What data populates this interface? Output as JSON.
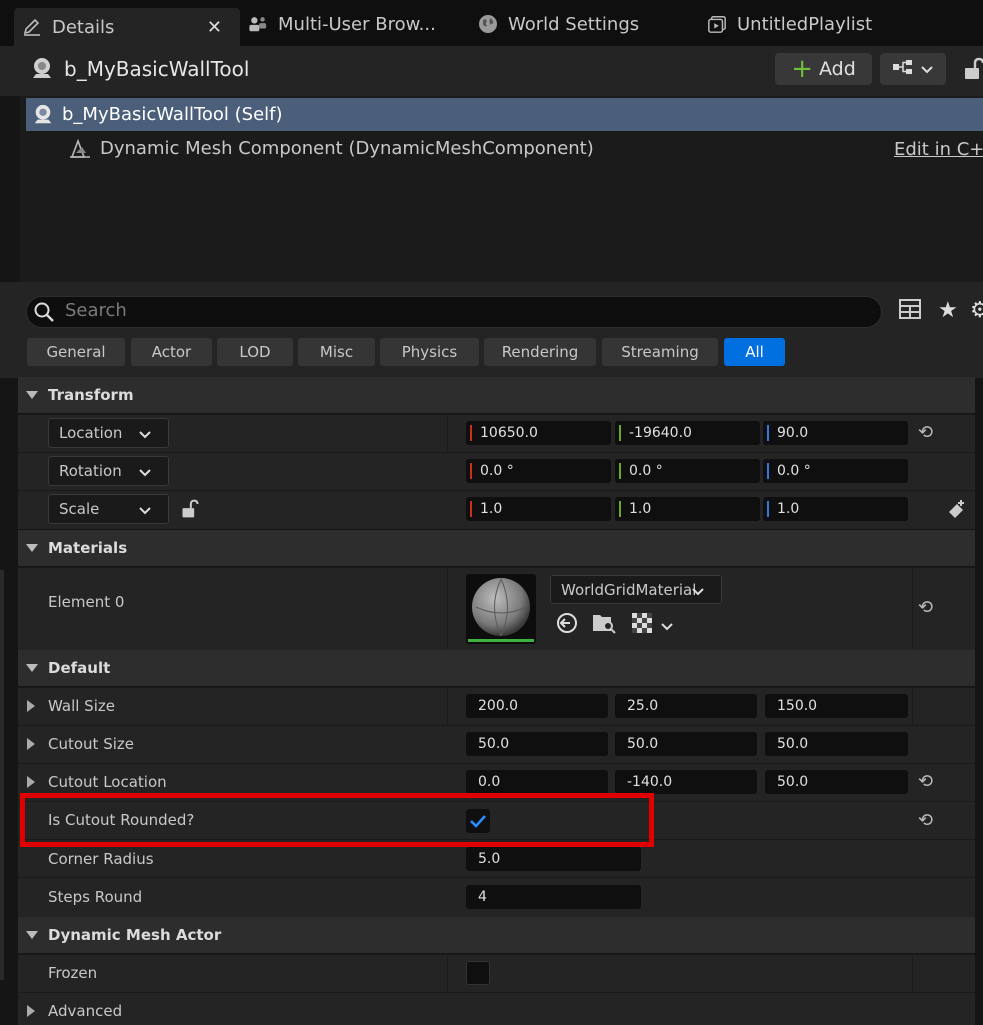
{
  "tabs": [
    {
      "label": "Details",
      "icon": "pencil-icon"
    },
    {
      "label": "Multi-User Brow...",
      "icon": "users-icon"
    },
    {
      "label": "World Settings",
      "icon": "globe-icon"
    },
    {
      "label": "UntitledPlaylist",
      "icon": "playlist-icon"
    }
  ],
  "header": {
    "title": "b_MyBasicWallTool",
    "add_label": "Add"
  },
  "components": {
    "self": "b_MyBasicWallTool (Self)",
    "child": "Dynamic Mesh Component (DynamicMeshComponent)",
    "edit_link": "Edit in C++"
  },
  "search": {
    "placeholder": "Search"
  },
  "categories": [
    "General",
    "Actor",
    "LOD",
    "Misc",
    "Physics",
    "Rendering",
    "Streaming",
    "All"
  ],
  "transform": {
    "title": "Transform",
    "location": {
      "label": "Location",
      "x": "10650.0",
      "y": "-19640.0",
      "z": "90.0"
    },
    "rotation": {
      "label": "Rotation",
      "x": "0.0 °",
      "y": "0.0 °",
      "z": "0.0 °"
    },
    "scale": {
      "label": "Scale",
      "x": "1.0",
      "y": "1.0",
      "z": "1.0"
    }
  },
  "materials": {
    "title": "Materials",
    "element_label": "Element 0",
    "material_name": "WorldGridMaterial"
  },
  "default": {
    "title": "Default",
    "wall_size": {
      "label": "Wall Size",
      "v1": "200.0",
      "v2": "25.0",
      "v3": "150.0"
    },
    "cutout_size": {
      "label": "Cutout Size",
      "v1": "50.0",
      "v2": "50.0",
      "v3": "50.0"
    },
    "cutout_location": {
      "label": "Cutout Location",
      "v1": "0.0",
      "v2": "-140.0",
      "v3": "50.0"
    },
    "is_cutout_rounded": {
      "label": "Is Cutout Rounded?",
      "checked": true
    },
    "corner_radius": {
      "label": "Corner Radius",
      "value": "5.0"
    },
    "steps_round": {
      "label": "Steps Round",
      "value": "4"
    }
  },
  "dynamic_mesh_actor": {
    "title": "Dynamic Mesh Actor",
    "frozen_label": "Frozen",
    "frozen_checked": false
  },
  "advanced": {
    "label": "Advanced"
  },
  "colors": {
    "accent": "#0070e0",
    "highlight": "#e00000",
    "axis_x": "#c8301e",
    "axis_y": "#6ba82a",
    "axis_z": "#3a78d8",
    "selected_row": "#4b5f7a"
  }
}
